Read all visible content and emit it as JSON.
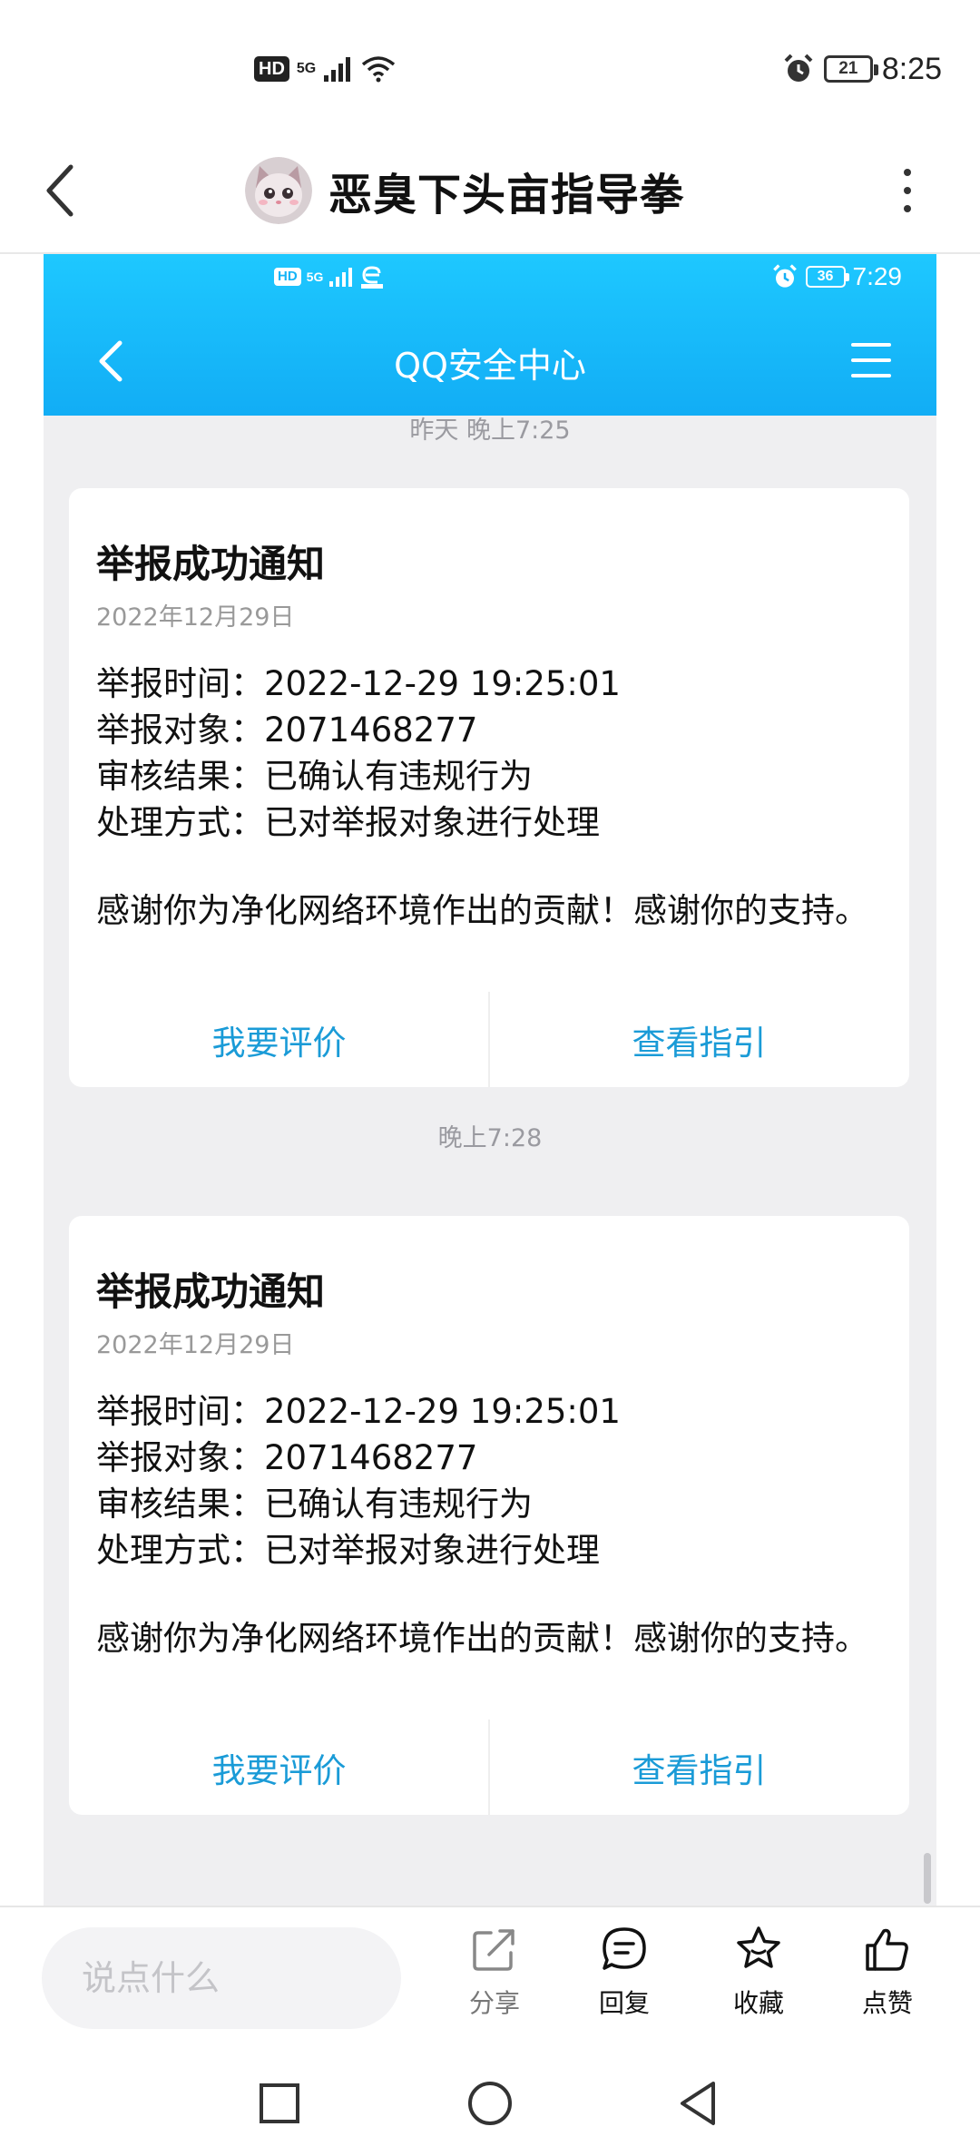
{
  "status_bar": {
    "hd": "HD",
    "network": "5G",
    "time": "8:25",
    "battery": "21"
  },
  "header": {
    "title": "恶臭下头亩指导拳"
  },
  "embedded": {
    "status_bar": {
      "hd": "HD",
      "network": "5G",
      "time": "7:29",
      "battery": "36"
    },
    "title": "QQ安全中心",
    "time_labels": [
      "昨天 晚上7:25",
      "晚上7:28"
    ],
    "cards": [
      {
        "title": "举报成功通知",
        "date": "2022年12月29日",
        "lines": [
          "举报时间：2022-12-29 19:25:01",
          "举报对象：2071468277",
          "审核结果：已确认有违规行为",
          "处理方式：已对举报对象进行处理"
        ],
        "message": "感谢你为净化网络环境作出的贡献！感谢你的支持。",
        "actions": [
          "我要评价",
          "查看指引"
        ]
      },
      {
        "title": "举报成功通知",
        "date": "2022年12月29日",
        "lines": [
          "举报时间：2022-12-29 19:25:01",
          "举报对象：2071468277",
          "审核结果：已确认有违规行为",
          "处理方式：已对举报对象进行处理"
        ],
        "message": "感谢你为净化网络环境作出的贡献！感谢你的支持。",
        "actions": [
          "我要评价",
          "查看指引"
        ]
      }
    ]
  },
  "bottom_bar": {
    "comment_placeholder": "说点什么",
    "actions": [
      {
        "label": "分享",
        "icon": "share-icon"
      },
      {
        "label": "回复",
        "icon": "reply-icon"
      },
      {
        "label": "收藏",
        "icon": "star-icon"
      },
      {
        "label": "点赞",
        "icon": "thumbs-up-icon"
      }
    ]
  },
  "colors": {
    "accent_link": "#1a9bd7",
    "qq_header_blue": "#12adf5",
    "page_gray": "#efeff1"
  }
}
